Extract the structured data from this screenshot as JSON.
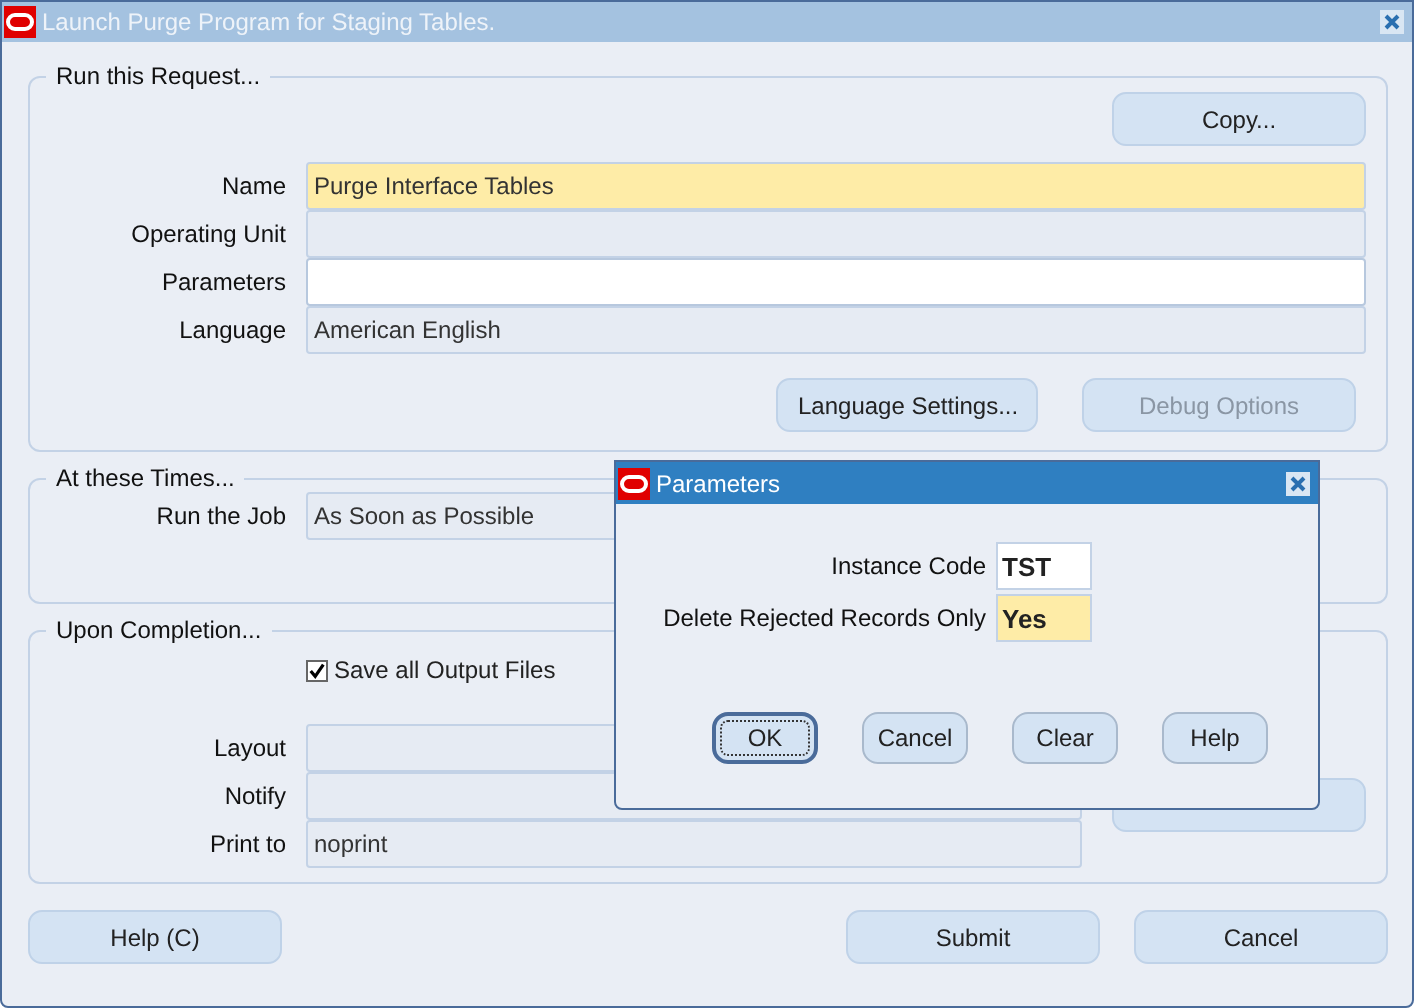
{
  "window": {
    "title": "Launch Purge Program for Staging Tables.",
    "active": false
  },
  "run_request": {
    "legend": "Run this Request...",
    "copy_button": {
      "label": "Copy...",
      "disabled": false
    },
    "fields": [
      {
        "label": "Name",
        "value": "Purge Interface Tables",
        "required": true
      },
      {
        "label": "Operating Unit",
        "required": false,
        "editable": false
      },
      {
        "label": "Parameters",
        "required": false,
        "editable": true
      },
      {
        "label": "Language",
        "value": "American English",
        "required": false,
        "editable": false
      }
    ],
    "buttons": [
      {
        "label": "Language Settings...",
        "disabled": false
      },
      {
        "label": "Debug Options",
        "disabled": true
      }
    ]
  },
  "schedule": {
    "legend": "At these Times...",
    "fields": [
      {
        "label": "Run the Job",
        "value": "As Soon as Possible",
        "required": false,
        "editable": false
      }
    ]
  },
  "completion": {
    "legend": "Upon Completion...",
    "save_output": {
      "label": "Save all Output Files",
      "checked": true
    },
    "fields": [
      {
        "label": "Layout",
        "required": false,
        "editable": false
      },
      {
        "label": "Notify",
        "required": false,
        "editable": false
      },
      {
        "label": "Print to",
        "value": "noprint",
        "required": false,
        "editable": false
      }
    ]
  },
  "footer": {
    "help_button": {
      "label": "Help (C)",
      "disabled": false
    },
    "buttons": [
      {
        "label": "Submit",
        "disabled": false
      },
      {
        "label": "Cancel",
        "disabled": false
      }
    ]
  },
  "dialog": {
    "title": "Parameters",
    "active": true,
    "fields": [
      {
        "label": "Instance Code",
        "value": "TST",
        "required": false
      },
      {
        "label": "Delete Rejected Records Only",
        "value": "Yes",
        "required": true
      }
    ],
    "buttons": [
      {
        "label": "OK",
        "focused": true
      },
      {
        "label": "Cancel",
        "focused": false
      },
      {
        "label": "Clear",
        "focused": false
      },
      {
        "label": "Help",
        "focused": false
      }
    ]
  }
}
